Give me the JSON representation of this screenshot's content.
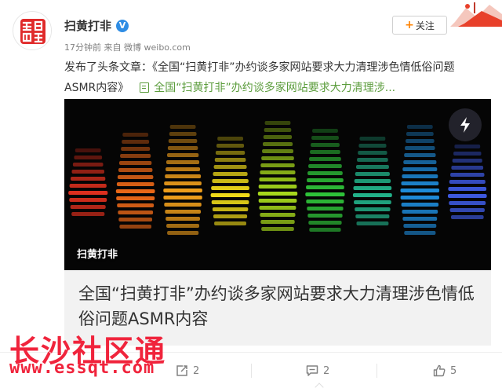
{
  "author": {
    "name": "扫黄打非",
    "verified_badge": "V",
    "avatar_seal_text": "扫黄打非"
  },
  "meta": {
    "time": "17分钟前",
    "source_prefix": "来自",
    "source": "微博 weibo.com"
  },
  "follow": {
    "plus": "+",
    "label": "关注"
  },
  "post": {
    "line1": "发布了头条文章：《全国“扫黄打非”办约谈多家网站要求大力清理涉色情低俗问题",
    "line2": "ASMR内容》",
    "link_text": "全国“扫黄打非”办约谈多家网站要求大力清理涉..."
  },
  "card": {
    "image_label": "扫黄打非",
    "title": "全国“扫黄打非”办约谈多家网站要求大力清理涉色情低俗问题ASMR内容",
    "equalizer_colors": [
      "#e0301e",
      "#f06a18",
      "#f5a21c",
      "#f2dc1a",
      "#a6d81c",
      "#2fc43a",
      "#23b58c",
      "#1f8fe0",
      "#3f5ce6"
    ]
  },
  "watermark": {
    "title": "长沙社区通",
    "url": "www.essqt.com",
    "color": "#f0243c"
  },
  "actions": {
    "repost_count": "2",
    "comment_count": "2",
    "like_count": "5"
  }
}
